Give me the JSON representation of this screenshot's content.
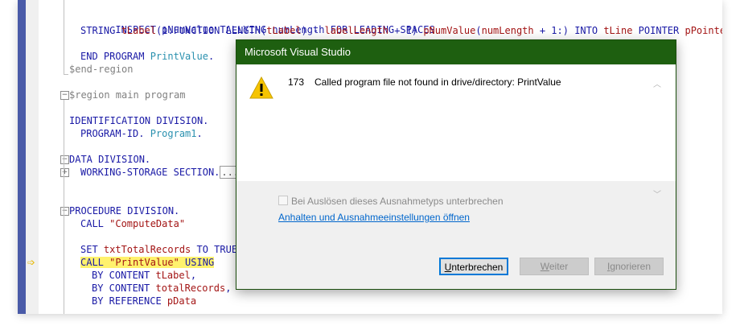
{
  "code": {
    "l1": {
      "a": "INSPECT pNumValue TALLYING numLength FOR LEADING SPACES"
    },
    "l2": {
      "a": "STRING ",
      "b": "tLabel",
      "c": "(1:FUNCTION LENGTH(",
      "d": "tLabel",
      "e": ") - ",
      "f": "labelLength",
      "g": " + 1) ",
      "h": "pNumValue",
      "i": "(",
      "j": "numLength",
      "k": " + 1:) INTO ",
      "l": "tLine",
      "m": " POINTER ",
      "n": "pPointer"
    },
    "l3": {
      "a": "END PROGRAM ",
      "b": "PrintValue",
      "c": "."
    },
    "l4": {
      "a": "$end-region"
    },
    "l5": {
      "a": "$region main program"
    },
    "l6": {
      "a": "IDENTIFICATION DIVISION."
    },
    "l7": {
      "a": "PROGRAM-ID. ",
      "b": "Program1",
      "c": "."
    },
    "l8": {
      "a": "DATA DIVISION."
    },
    "l9": {
      "a": "WORKING-STORAGE SECTION.",
      "b": "..."
    },
    "l10": {
      "a": "PROCEDURE DIVISION."
    },
    "l11": {
      "a": "CALL ",
      "b": "\"ComputeData\""
    },
    "l12": {
      "a": "SET ",
      "b": "txtTotalRecords",
      "c": " TO TRUE"
    },
    "l13": {
      "a": "CALL ",
      "b": "\"PrintValue\"",
      "c": " USING"
    },
    "l14": {
      "a": "BY CONTENT ",
      "b": "tLabel",
      "c": ","
    },
    "l15": {
      "a": "BY CONTENT ",
      "b": "totalRecords",
      "c": ","
    },
    "l16": {
      "a": "BY REFERENCE ",
      "b": "pData"
    }
  },
  "dialog": {
    "title": "Microsoft Visual Studio",
    "code": "173",
    "message": "Called program file not found in drive/directory: PrintValue",
    "checkbox_label": "Bei Auslösen dieses Ausnahmetyps unterbrechen",
    "link": "Anhalten und Ausnahmeeinstellungen öffnen",
    "buttons": {
      "break_u": "U",
      "break_rest": "nterbrechen",
      "continue_u": "W",
      "continue_rest": "eiter",
      "ignore_u": "I",
      "ignore_rest": "gnorieren"
    }
  },
  "icons": {
    "warning": "warning-icon",
    "arrow": "execution-arrow-icon"
  },
  "colors": {
    "title_bar": "#1e5f10",
    "link": "#0066cc",
    "keyword": "#1a1aa6",
    "string": "#a31515",
    "identifier": "#2b91af"
  }
}
